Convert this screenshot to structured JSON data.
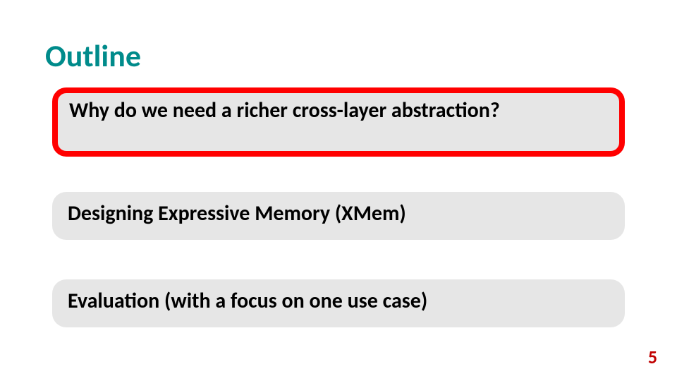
{
  "title": "Outline",
  "items": [
    {
      "text": "Why do we need a richer cross-layer abstraction?",
      "highlighted": true
    },
    {
      "text": "Designing Expressive Memory (XMem)",
      "highlighted": false
    },
    {
      "text": "Evaluation (with a focus on one use case)",
      "highlighted": false
    }
  ],
  "page_number": "5",
  "colors": {
    "title": "#008b8b",
    "highlight_border": "#ff0000",
    "box_bg": "#e6e6e6",
    "page_number": "#c00000"
  }
}
